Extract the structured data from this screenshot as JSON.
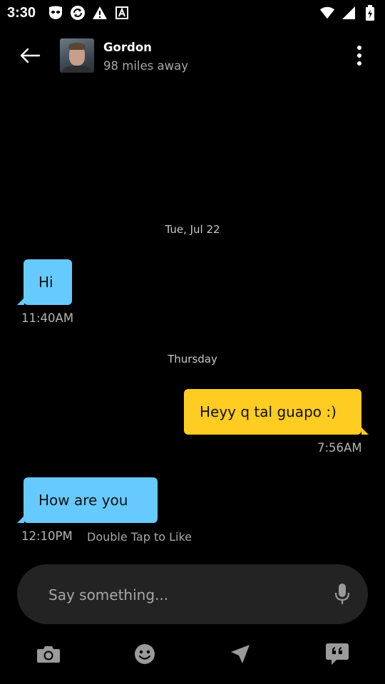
{
  "status_bar": {
    "time": "3:30",
    "left_icons": [
      "grindr-mask-icon",
      "sync-icon",
      "warning-icon",
      "a-box-icon"
    ],
    "right_icons": [
      "wifi-icon",
      "signal-icon",
      "battery-icon"
    ]
  },
  "header": {
    "contact_name": "Gordon",
    "distance": "98 miles away"
  },
  "conversation": {
    "date_separators": [
      "Tue, Jul 22",
      "Thursday"
    ],
    "messages": [
      {
        "direction": "in",
        "text": "Hi",
        "time": "11:40AM"
      },
      {
        "direction": "out",
        "text": "Heyy q tal guapo :)",
        "time": "7:56AM"
      },
      {
        "direction": "in",
        "text": "How are you",
        "time": "12:10PM",
        "hint": "Double Tap to Like"
      }
    ]
  },
  "composer": {
    "placeholder": "Say something..."
  },
  "bottom_bar": {
    "icons": [
      "camera-icon",
      "emoji-icon",
      "location-icon",
      "saved-phrases-icon"
    ]
  },
  "colors": {
    "background": "#000000",
    "incoming_bubble": "#66caff",
    "outgoing_bubble": "#ffcc22",
    "composer_bg": "#232323"
  }
}
